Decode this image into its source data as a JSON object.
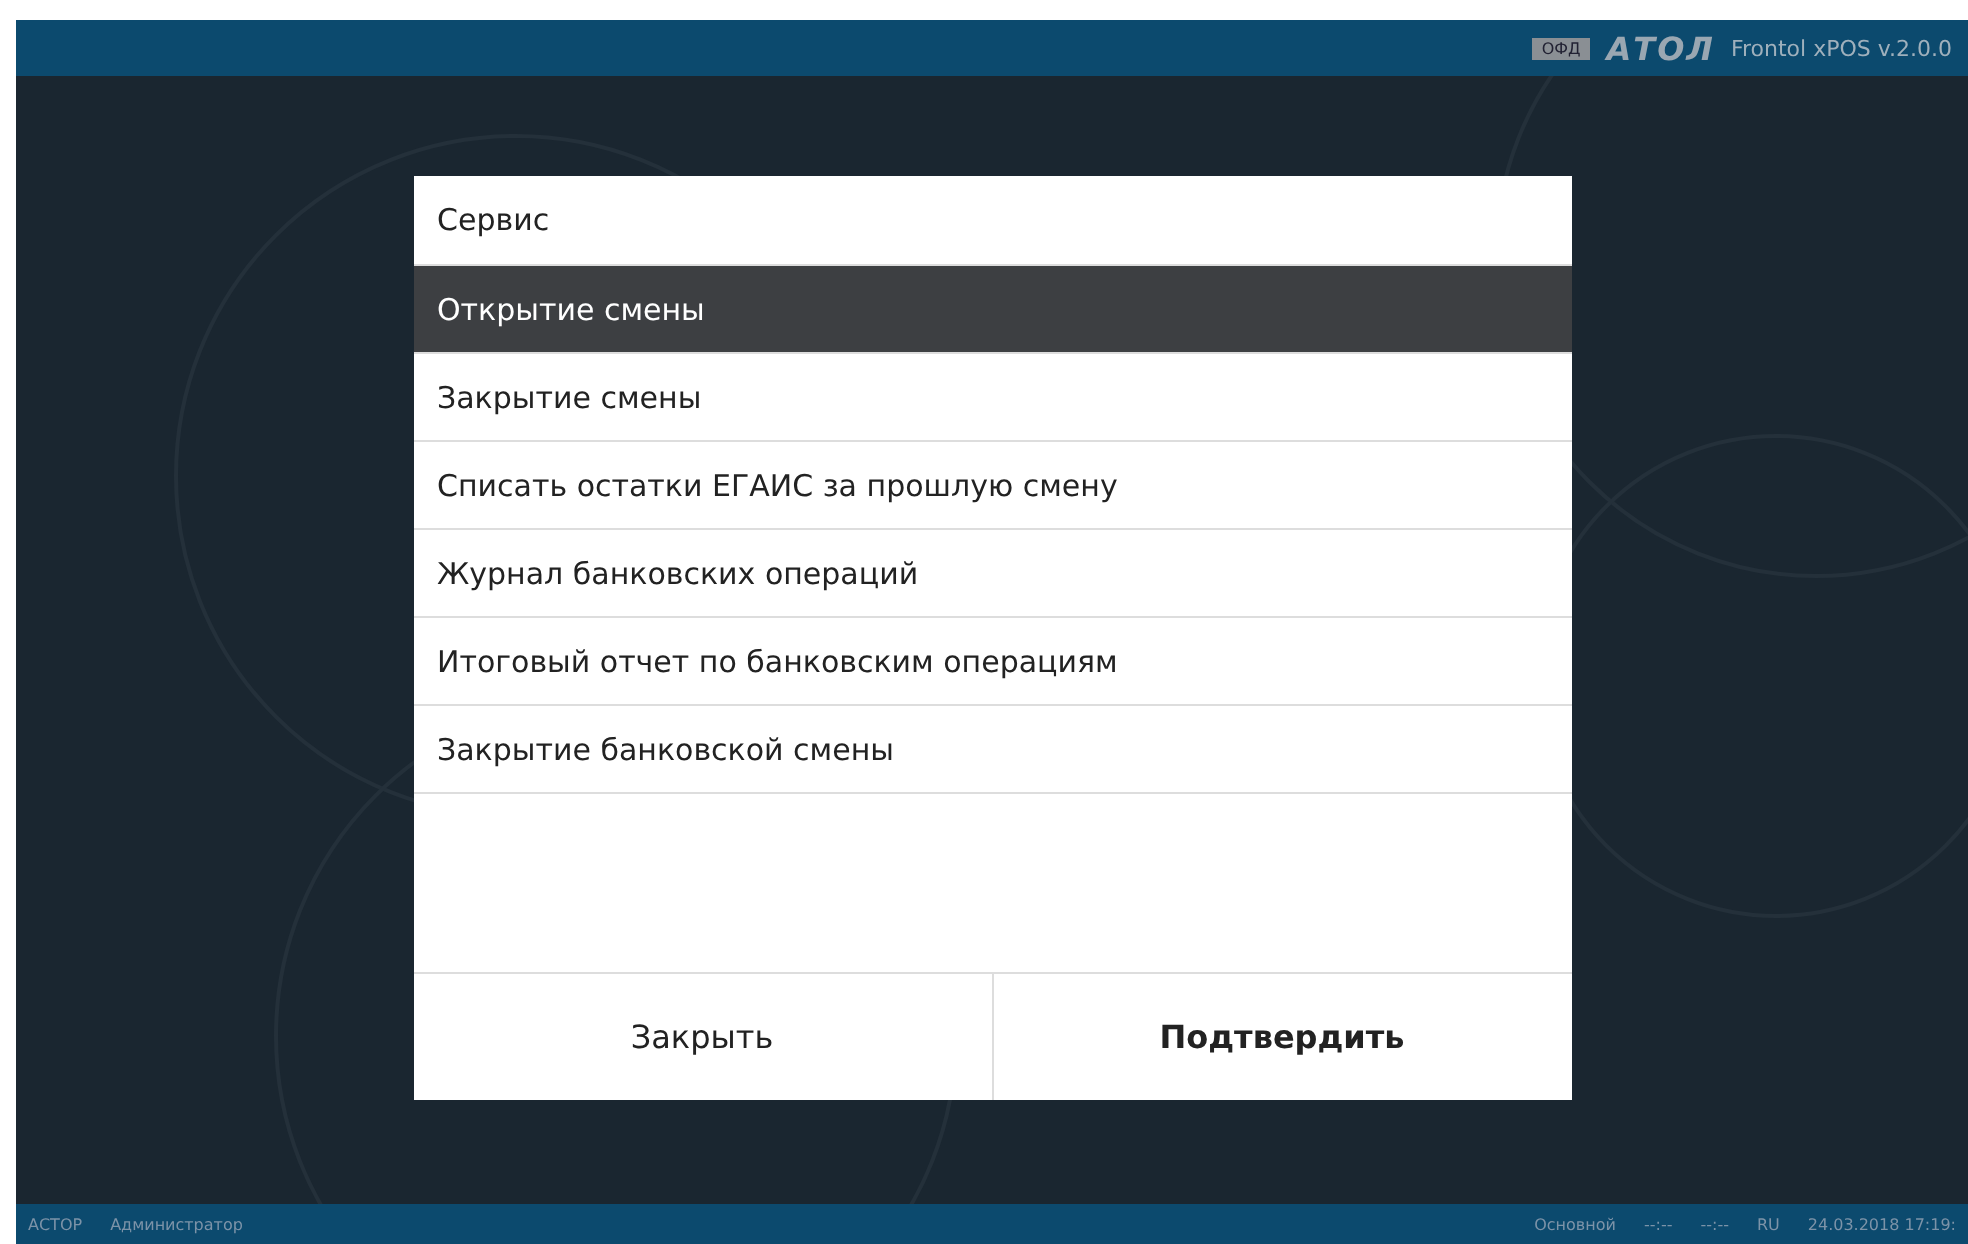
{
  "header": {
    "badge": "ОФД",
    "logo": "АТОЛ",
    "product": "Frontol xPOS v.2.0.0"
  },
  "dialog": {
    "title": "Сервис",
    "items": [
      {
        "label": "Открытие смены",
        "selected": true
      },
      {
        "label": "Закрытие смены",
        "selected": false
      },
      {
        "label": "Списать остатки ЕГАИС за прошлую смену",
        "selected": false
      },
      {
        "label": "Журнал банковских операций",
        "selected": false
      },
      {
        "label": "Итоговый отчет по банковским операциям",
        "selected": false
      },
      {
        "label": "Закрытие банковской смены",
        "selected": false
      }
    ],
    "buttons": [
      {
        "label": "Закрыть",
        "kind": "secondary"
      },
      {
        "label": "Подтвердить",
        "kind": "primary"
      }
    ]
  },
  "status_bar": {
    "left": [
      "АСТОР",
      "Администратор"
    ],
    "right": [
      "Основной",
      "--:--",
      "--:--",
      "RU",
      "24.03.2018 17:19:"
    ]
  }
}
